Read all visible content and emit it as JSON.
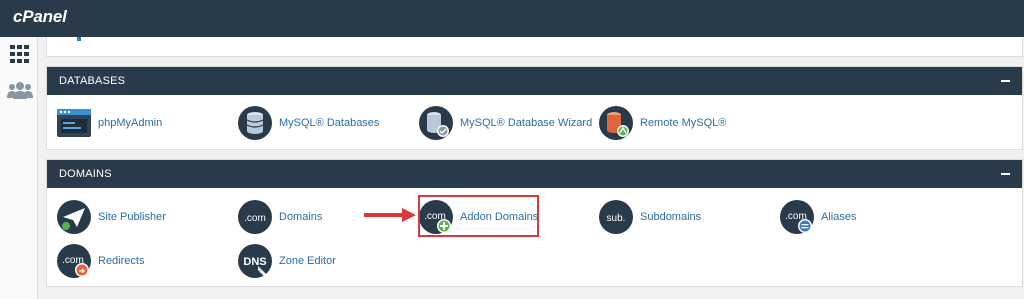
{
  "header": {
    "logo_text": "cPanel"
  },
  "sidebar": {
    "items": [
      {
        "icon": "grid-icon"
      },
      {
        "icon": "users-icon"
      }
    ]
  },
  "databases": {
    "title": "DATABASES",
    "items": [
      {
        "label": "phpMyAdmin",
        "icon": "phpmyadmin-icon"
      },
      {
        "label": "MySQL® Databases",
        "icon": "database-icon"
      },
      {
        "label": "MySQL® Database Wizard",
        "icon": "database-wizard-icon"
      },
      {
        "label": "Remote MySQL®",
        "icon": "remote-database-icon"
      }
    ]
  },
  "domains": {
    "title": "DOMAINS",
    "items": [
      {
        "label": "Site Publisher",
        "icon": "site-publisher-icon"
      },
      {
        "label": "Domains",
        "icon": "domains-icon",
        "icon_text": ".com"
      },
      {
        "label": "Addon Domains",
        "icon": "addon-domains-icon",
        "icon_text": ".com"
      },
      {
        "label": "Subdomains",
        "icon": "subdomains-icon",
        "icon_text": "sub."
      },
      {
        "label": "Aliases",
        "icon": "aliases-icon",
        "icon_text": ".com"
      },
      {
        "label": "Redirects",
        "icon": "redirects-icon",
        "icon_text": ".com"
      },
      {
        "label": "Zone Editor",
        "icon": "zone-editor-icon",
        "icon_text": "DNS"
      }
    ]
  },
  "colors": {
    "topbar": "#293a4a",
    "link": "#2d6da3",
    "highlight": "#d9393a"
  }
}
